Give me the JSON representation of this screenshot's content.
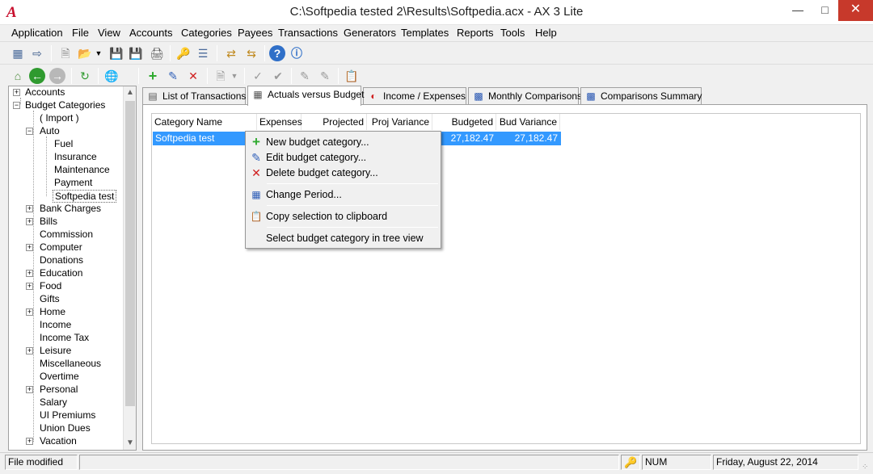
{
  "window": {
    "title": "C:\\Softpedia tested 2\\Results\\Softpedia.acx - AX 3 Lite",
    "icon": "ax-logo-icon"
  },
  "menu": [
    "Application",
    "File",
    "View",
    "Accounts",
    "Categories",
    "Payees",
    "Transactions",
    "Generators",
    "Templates",
    "Reports",
    "Tools",
    "Help"
  ],
  "tree": {
    "items": [
      {
        "label": "Accounts"
      },
      {
        "label": "Budget Categories"
      },
      {
        "label": "( Import )"
      },
      {
        "label": "Auto"
      },
      {
        "label": "Fuel"
      },
      {
        "label": "Insurance"
      },
      {
        "label": "Maintenance"
      },
      {
        "label": "Payment"
      },
      {
        "label": "Softpedia test"
      },
      {
        "label": "Bank Charges"
      },
      {
        "label": "Bills"
      },
      {
        "label": "Commission"
      },
      {
        "label": "Computer"
      },
      {
        "label": "Donations"
      },
      {
        "label": "Education"
      },
      {
        "label": "Food"
      },
      {
        "label": "Gifts"
      },
      {
        "label": "Home"
      },
      {
        "label": "Income"
      },
      {
        "label": "Income Tax"
      },
      {
        "label": "Leisure"
      },
      {
        "label": "Miscellaneous"
      },
      {
        "label": "Overtime"
      },
      {
        "label": "Personal"
      },
      {
        "label": "Salary"
      },
      {
        "label": "UI Premiums"
      },
      {
        "label": "Union Dues"
      },
      {
        "label": "Vacation"
      }
    ]
  },
  "tabs": [
    {
      "label": "List of Transactions",
      "icon": "list-icon"
    },
    {
      "label": "Actuals versus Budget",
      "icon": "table-icon"
    },
    {
      "label": "Income / Expenses",
      "icon": "pie-chart-icon"
    },
    {
      "label": "Monthly Comparisons",
      "icon": "bar-chart-icon"
    },
    {
      "label": "Comparisons Summary",
      "icon": "bar-chart-icon"
    }
  ],
  "grid": {
    "columns": [
      "Category Name",
      "Expenses",
      "Projected",
      "Proj Variance",
      "Budgeted",
      "Bud Variance"
    ],
    "rows": [
      {
        "category": "Softpedia test",
        "budgeted": "27,182.47",
        "bud_variance": "27,182.47"
      }
    ]
  },
  "context_menu": {
    "items": [
      {
        "label": "New budget category...",
        "icon": "plus-icon"
      },
      {
        "label": "Edit budget category...",
        "icon": "pencil-icon"
      },
      {
        "label": "Delete budget category...",
        "icon": "delete-icon"
      },
      {
        "label": "Change Period...",
        "icon": "calendar-icon"
      },
      {
        "label": "Copy selection to clipboard",
        "icon": "clipboard-icon"
      },
      {
        "label": "Select budget category in tree view",
        "icon": ""
      }
    ]
  },
  "status": {
    "left": "File modified",
    "num": "NUM",
    "date": "Friday, August 22, 2014"
  },
  "colors": {
    "selection": "#3399ff",
    "close_button": "#c7392b",
    "accent_red": "#c8102e"
  }
}
